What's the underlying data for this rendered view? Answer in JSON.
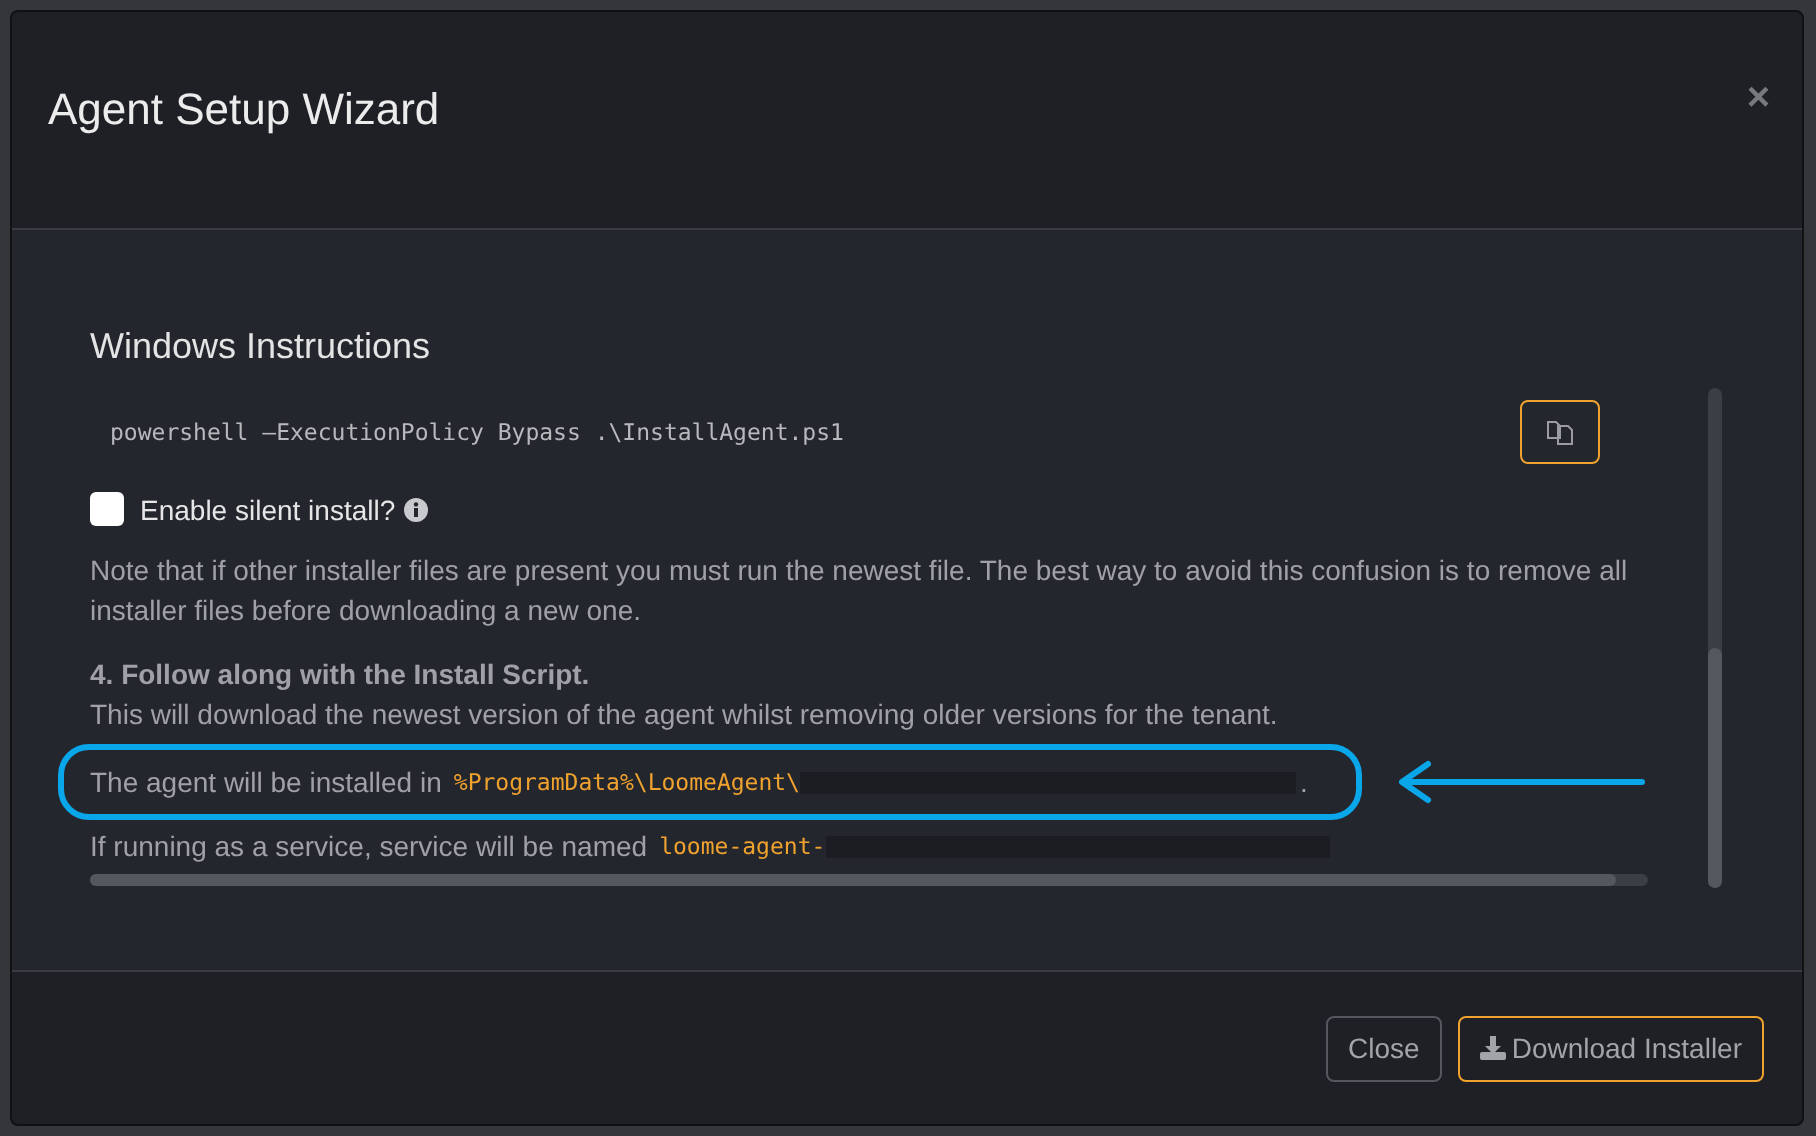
{
  "dialog": {
    "title": "Agent Setup Wizard",
    "close": "×"
  },
  "section_title": "Windows Instructions",
  "command": "powershell –ExecutionPolicy Bypass .\\InstallAgent.ps1",
  "silent_install": {
    "label": "Enable silent install?",
    "checked": false
  },
  "note": "Note that if other installer files are present you must run the newest file. The best way to avoid this confusion is to remove all installer files before downloading a new one.",
  "step": {
    "heading": "4. Follow along with the Install Script.",
    "text": "This will download the newest version of the agent whilst removing older versions for the tenant."
  },
  "install_path": {
    "prefix": "The agent will be installed in",
    "code": "%ProgramData%\\LoomeAgent\\",
    "suffix": "."
  },
  "service_name": {
    "prefix": "If running as a service, service will be named",
    "code": "loome-agent-"
  },
  "buttons": [
    {
      "label": "Close",
      "kind": "secondary"
    },
    {
      "label": "Download Installer",
      "kind": "primary"
    }
  ]
}
